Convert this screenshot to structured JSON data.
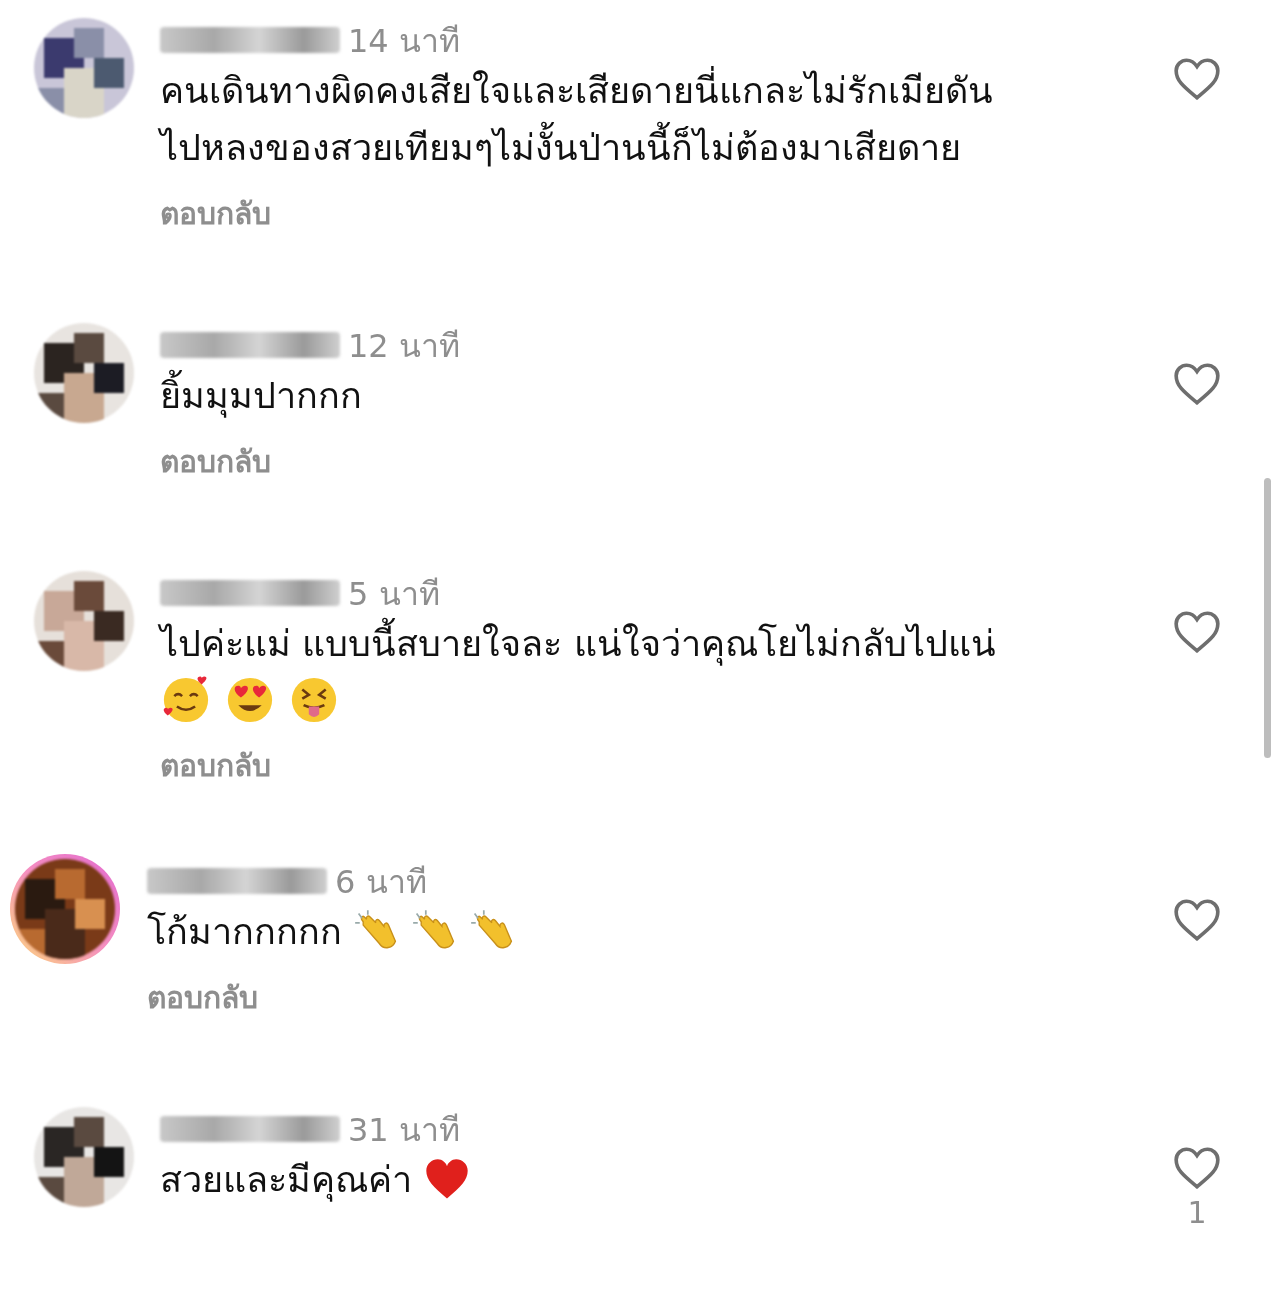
{
  "comments": [
    {
      "time": "14 นาที",
      "lines": [
        "คนเดินทางผิดคงเสียใจและเสียดายนี่แกละไม่รักเมียดัน",
        "ไปหลงของสวยเทียมๆไม่งั้นป่านนี้ก็ไม่ต้องมาเสียดาย"
      ],
      "reply": "ตอบกลับ",
      "liked": false,
      "story_ring": false
    },
    {
      "time": "12 นาที",
      "lines": [
        "ยิ้มมุมปากกก"
      ],
      "reply": "ตอบกลับ",
      "liked": false,
      "story_ring": false
    },
    {
      "time": "5 นาที",
      "lines": [
        "ไปค่ะแม่ แบบนี้สบายใจละ แน่ใจว่าคุณโยไม่กลับไปแน่"
      ],
      "emoji_line": [
        {
          "kind": "smiling-hearts"
        },
        {
          "kind": "heart-eyes"
        },
        {
          "kind": "squint-tongue"
        }
      ],
      "reply": "ตอบกลับ",
      "liked": false,
      "story_ring": false
    },
    {
      "time": "6 นาที",
      "lines": [
        "โก้มากกกกก"
      ],
      "emoji": [
        {
          "kind": "clap"
        },
        {
          "kind": "clap"
        },
        {
          "kind": "clap"
        }
      ],
      "reply": "ตอบกลับ",
      "liked": false,
      "story_ring": true
    },
    {
      "time": "31 นาที",
      "lines": [
        "สวยและมีคุณค่า"
      ],
      "emoji": [
        {
          "kind": "heart"
        }
      ],
      "liked": false,
      "story_ring": false,
      "like_count": "1"
    }
  ]
}
